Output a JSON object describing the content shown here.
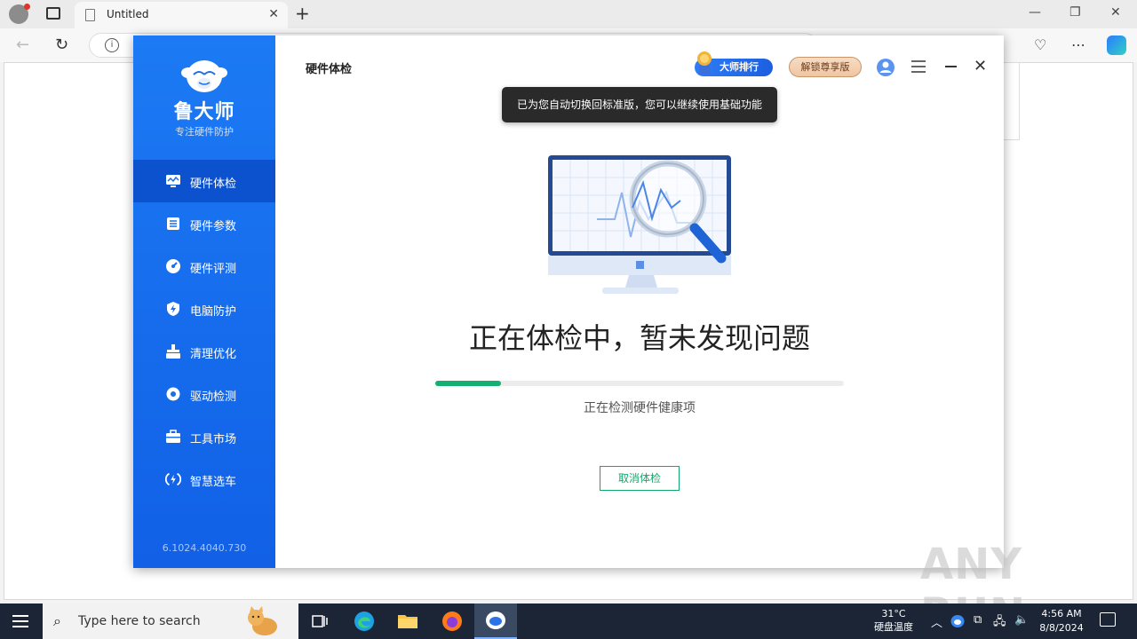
{
  "browser": {
    "tab_title": "Untitled",
    "new_tab": "+",
    "tab_close": "✕",
    "win_min": "—",
    "win_restore": "❐",
    "win_close": "✕"
  },
  "app": {
    "brand": "鲁大师",
    "slogan": "专注硬件防护",
    "page_title": "硬件体检",
    "version": "6.1024.4040.730",
    "rank_label": "大师排行",
    "unlock_label": "解锁尊享版",
    "tooltip": "已为您自动切换回标准版，您可以继续使用基础功能",
    "status": "正在体检中，暂未发现问题",
    "substatus": "正在检测硬件健康项",
    "cancel_label": "取消体检",
    "progress": 0.16,
    "accent": "#1c7af4",
    "progress_color": "#15b070",
    "menu": [
      {
        "label": "硬件体检",
        "icon": "hardware-check-icon",
        "active": true
      },
      {
        "label": "硬件参数",
        "icon": "hardware-params-icon",
        "active": false
      },
      {
        "label": "硬件评测",
        "icon": "benchmark-icon",
        "active": false
      },
      {
        "label": "电脑防护",
        "icon": "shield-icon",
        "active": false
      },
      {
        "label": "清理优化",
        "icon": "broom-icon",
        "active": false
      },
      {
        "label": "驱动检测",
        "icon": "driver-gear-icon",
        "active": false
      },
      {
        "label": "工具市场",
        "icon": "toolbox-icon",
        "active": false
      },
      {
        "label": "智慧选车",
        "icon": "smart-car-icon",
        "active": false
      }
    ]
  },
  "watermark": "ANY RUN",
  "taskbar": {
    "search_placeholder": "Type here to search",
    "temp": "31°C",
    "temp_label": "硬盘温度",
    "time": "4:56 AM",
    "date": "8/8/2024"
  }
}
